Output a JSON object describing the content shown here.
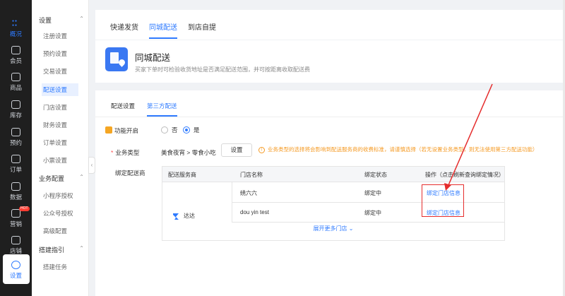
{
  "rail": {
    "items": [
      {
        "label": "概况",
        "icon": "grid-icon"
      },
      {
        "label": "会员",
        "icon": "crown-icon"
      },
      {
        "label": "商品",
        "icon": "shop-icon"
      },
      {
        "label": "库存",
        "icon": "box-icon"
      },
      {
        "label": "预约",
        "icon": "calendar-icon"
      },
      {
        "label": "订单",
        "icon": "order-icon"
      },
      {
        "label": "数据",
        "icon": "chart-icon"
      },
      {
        "label": "营销",
        "icon": "gift-icon"
      },
      {
        "label": "店铺",
        "icon": "store-icon"
      },
      {
        "label": "设置",
        "icon": "settings-icon"
      }
    ],
    "hot_badge": "HOT"
  },
  "submenu": {
    "group1": "设置",
    "group1_items": [
      "注册设置",
      "预约设置",
      "交易设置",
      "配送设置",
      "门店设置",
      "财务设置",
      "订单设置",
      "小票设置"
    ],
    "group2": "业务配置",
    "group2_items": [
      "小程序授权",
      "公众号授权",
      "高级配置"
    ],
    "group3": "搭建指引",
    "group3_items": [
      "搭建任务"
    ]
  },
  "top_tabs": [
    "快递发货",
    "同城配送",
    "到店自提"
  ],
  "hero": {
    "title": "同城配送",
    "desc": "买家下单时可检验收货地址是否满足配送范围，并可按距离收取配送费"
  },
  "sub_tabs": [
    "配送设置",
    "第三方配送"
  ],
  "form": {
    "func_label": "功能开启",
    "radio_no": "否",
    "radio_yes": "是",
    "biz_label": "业务类型",
    "biz_value": "美食夜宵 > 零食小吃",
    "set_button": "设置",
    "warning": "业务类型的选择将会影响到配送服务商的收费标准，请谨慎选择（若无设置业务类型，则无法使用第三方配送功能）",
    "bind_label": "绑定配送商"
  },
  "table": {
    "headers": [
      "配送服务商",
      "门店名称",
      "绑定状态",
      "操作（点击刷新查询绑定情况）"
    ],
    "provider": "达达",
    "rows": [
      {
        "store": "绣六六",
        "status": "绑定中",
        "action": "绑定门店信息"
      },
      {
        "store": "dou yin test",
        "status": "绑定中",
        "action": "绑定门店信息"
      }
    ],
    "expand": "展开更多门店 ⌄"
  },
  "colors": {
    "accent": "#2f7bff",
    "rail_bg": "#1f1f1f",
    "annotation": "#e52d2d",
    "warning": "#f59a23"
  }
}
